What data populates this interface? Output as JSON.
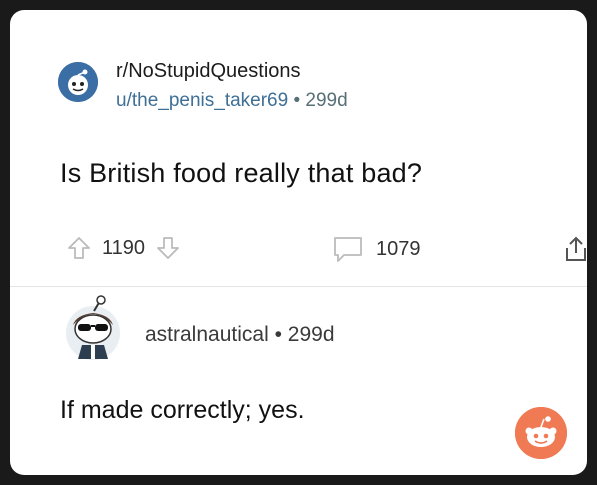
{
  "post": {
    "subreddit": "r/NoStupidQuestions",
    "author": "u/the_penis_taker69",
    "separator": "•",
    "age": "299d",
    "title": "Is British food really that bad?"
  },
  "actions": {
    "votes": "1190",
    "comments": "1079"
  },
  "comment": {
    "author": "astralnautical",
    "separator": "•",
    "age": "299d",
    "body": "If made correctly; yes."
  },
  "colors": {
    "background": "#1a1a1b",
    "card": "#ffffff",
    "username_link": "#3e6f96",
    "reddit_orange": "#ef7a54"
  }
}
